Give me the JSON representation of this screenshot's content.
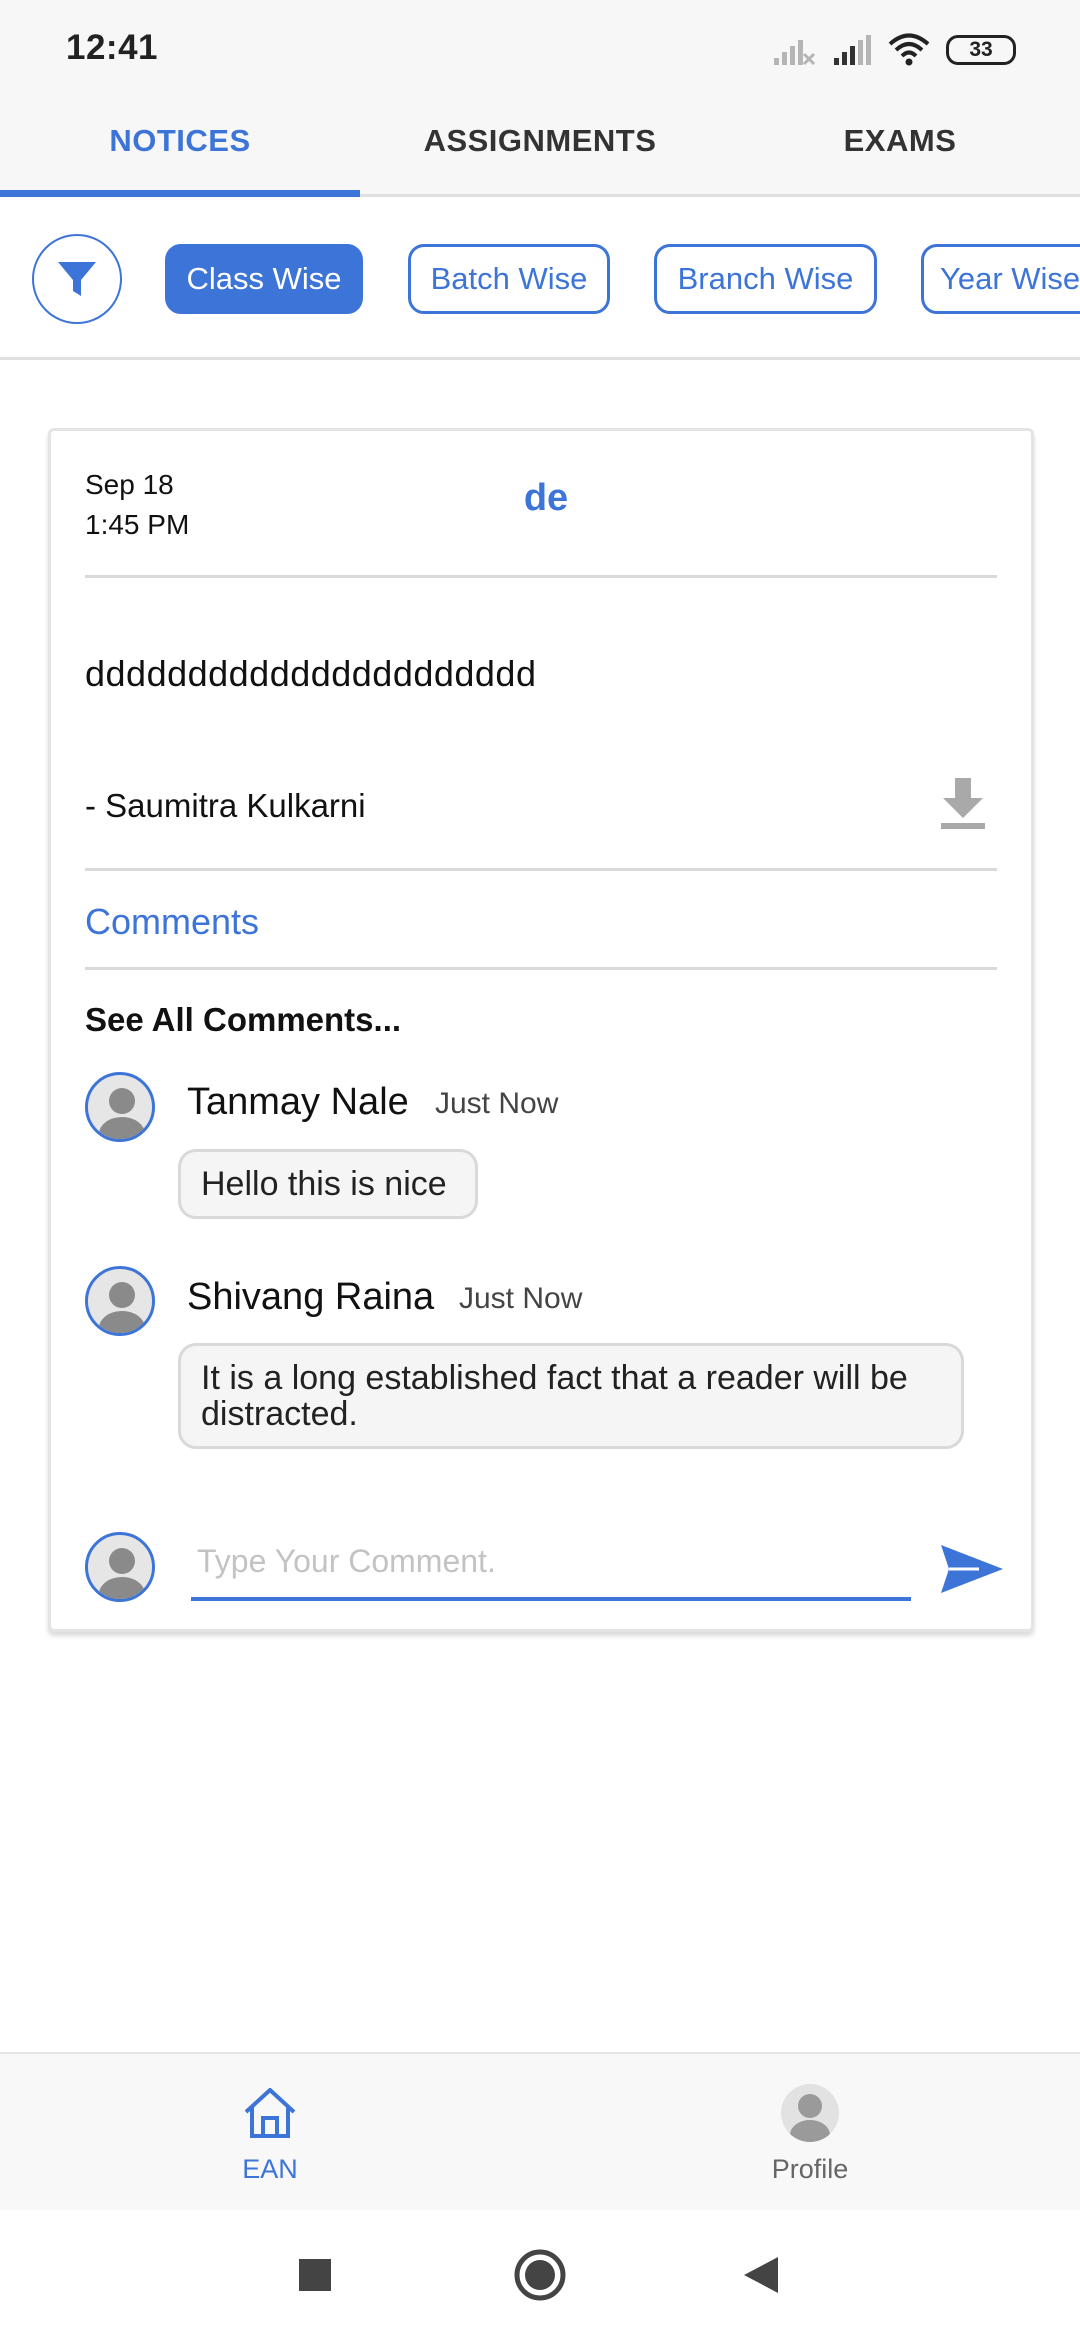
{
  "status_bar": {
    "time": "12:41",
    "battery": "33",
    "icons": [
      "signal-off-icon",
      "signal-icon",
      "wifi-icon",
      "battery-icon"
    ]
  },
  "tabs": [
    {
      "label": "NOTICES",
      "active": true
    },
    {
      "label": "ASSIGNMENTS",
      "active": false
    },
    {
      "label": "EXAMS",
      "active": false
    }
  ],
  "filters": {
    "icon": "filter-icon",
    "chips": [
      {
        "label": "Class Wise",
        "active": true
      },
      {
        "label": "Batch Wise",
        "active": false
      },
      {
        "label": "Branch Wise",
        "active": false
      },
      {
        "label": "Year Wise",
        "active": false
      }
    ]
  },
  "notice": {
    "date": "Sep 18",
    "time": "1:45 PM",
    "title": "de",
    "body": "dddddddddddddddddddddd",
    "author": "- Saumitra Kulkarni",
    "comments_label": "Comments",
    "see_all_label": "See All Comments...",
    "comments": [
      {
        "name": "Tanmay Nale",
        "time": "Just Now",
        "text": "Hello this is nice"
      },
      {
        "name": "Shivang Raina",
        "time": "Just Now",
        "text": "It is a long established fact that a reader will be distracted."
      }
    ],
    "comment_input": {
      "placeholder": "Type Your Comment.",
      "value": ""
    }
  },
  "bottom_nav": [
    {
      "label": "EAN",
      "icon": "home-icon",
      "active": true
    },
    {
      "label": "Profile",
      "icon": "profile-icon",
      "active": false
    }
  ],
  "colors": {
    "accent": "#3d74d8",
    "divider": "#d9d9d9",
    "bubble_bg": "#f5f5f5"
  }
}
